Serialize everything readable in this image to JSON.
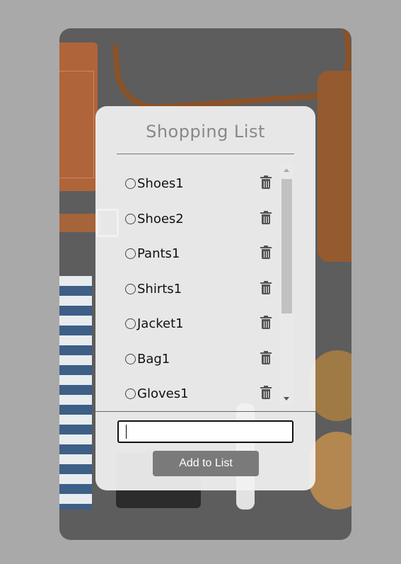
{
  "panel": {
    "title": "Shopping List"
  },
  "items": [
    {
      "label": "Shoes1"
    },
    {
      "label": "Shoes2"
    },
    {
      "label": "Pants1"
    },
    {
      "label": "Shirts1"
    },
    {
      "label": "Jacket1"
    },
    {
      "label": "Bag1"
    },
    {
      "label": "Gloves1"
    }
  ],
  "input": {
    "value": "",
    "placeholder": ""
  },
  "add_button": {
    "label": "Add to List"
  },
  "icons": {
    "item_toggle": "circle-outline-icon",
    "item_delete": "trash-icon",
    "scroll_up": "triangle-up-icon",
    "scroll_down": "triangle-down-icon"
  },
  "colors": {
    "page_background": "#a9a9a9",
    "panel_background": "#f2f2f2",
    "title_text": "#888888",
    "button_background": "#7a7a7a",
    "button_text": "#ffffff",
    "icon": "#555555"
  }
}
